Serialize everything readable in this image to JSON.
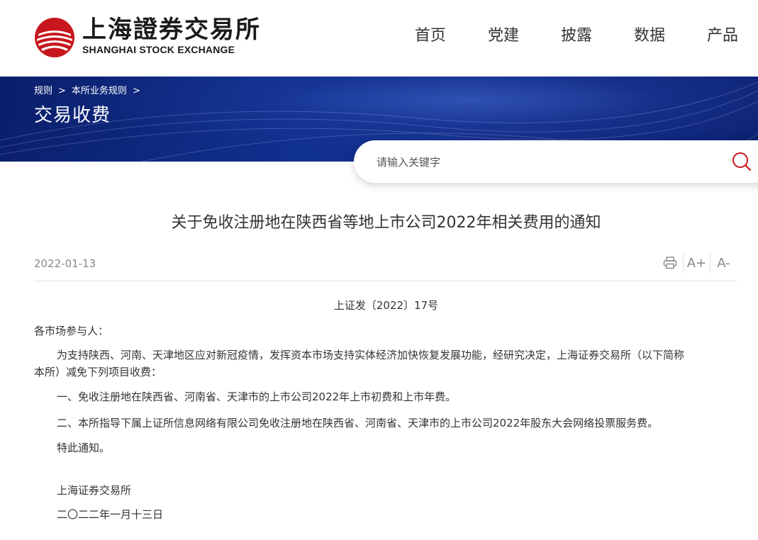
{
  "header": {
    "logo_cn": "上海證券交易所",
    "logo_en": "SHANGHAI STOCK EXCHANGE",
    "nav": [
      "首页",
      "党建",
      "披露",
      "数据",
      "产品"
    ]
  },
  "banner": {
    "breadcrumb": [
      "规则",
      "本所业务规则"
    ],
    "breadcrumb_sep": ">",
    "title": "交易收费"
  },
  "search": {
    "placeholder": "请输入关键字"
  },
  "article": {
    "title": "关于免收注册地在陕西省等地上市公司2022年相关费用的通知",
    "date": "2022-01-13",
    "tools": {
      "print_icon": "printer-icon",
      "font_increase": "A+",
      "font_decrease": "A-"
    },
    "doc_no": "上证发〔2022〕17号",
    "salutation": "各市场参与人：",
    "para1_line1": "为支持陕西、河南、天津地区应对新冠疫情，发挥资本市场支持实体经济加快恢复发展功能，经研究决定，上海证券交易所（以下简称",
    "para1_line2": "本所）减免下列项目收费：",
    "item1": "一、免收注册地在陕西省、河南省、天津市的上市公司2022年上市初费和上市年费。",
    "item2": "二、本所指导下属上证所信息网络有限公司免收注册地在陕西省、河南省、天津市的上市公司2022年股东大会网络投票服务费。",
    "closing": "特此通知。",
    "signature": "上海证券交易所",
    "sign_date": "二〇二二年一月十三日"
  },
  "colors": {
    "brand_red": "#c8161d",
    "banner_blue": "#10308f"
  }
}
